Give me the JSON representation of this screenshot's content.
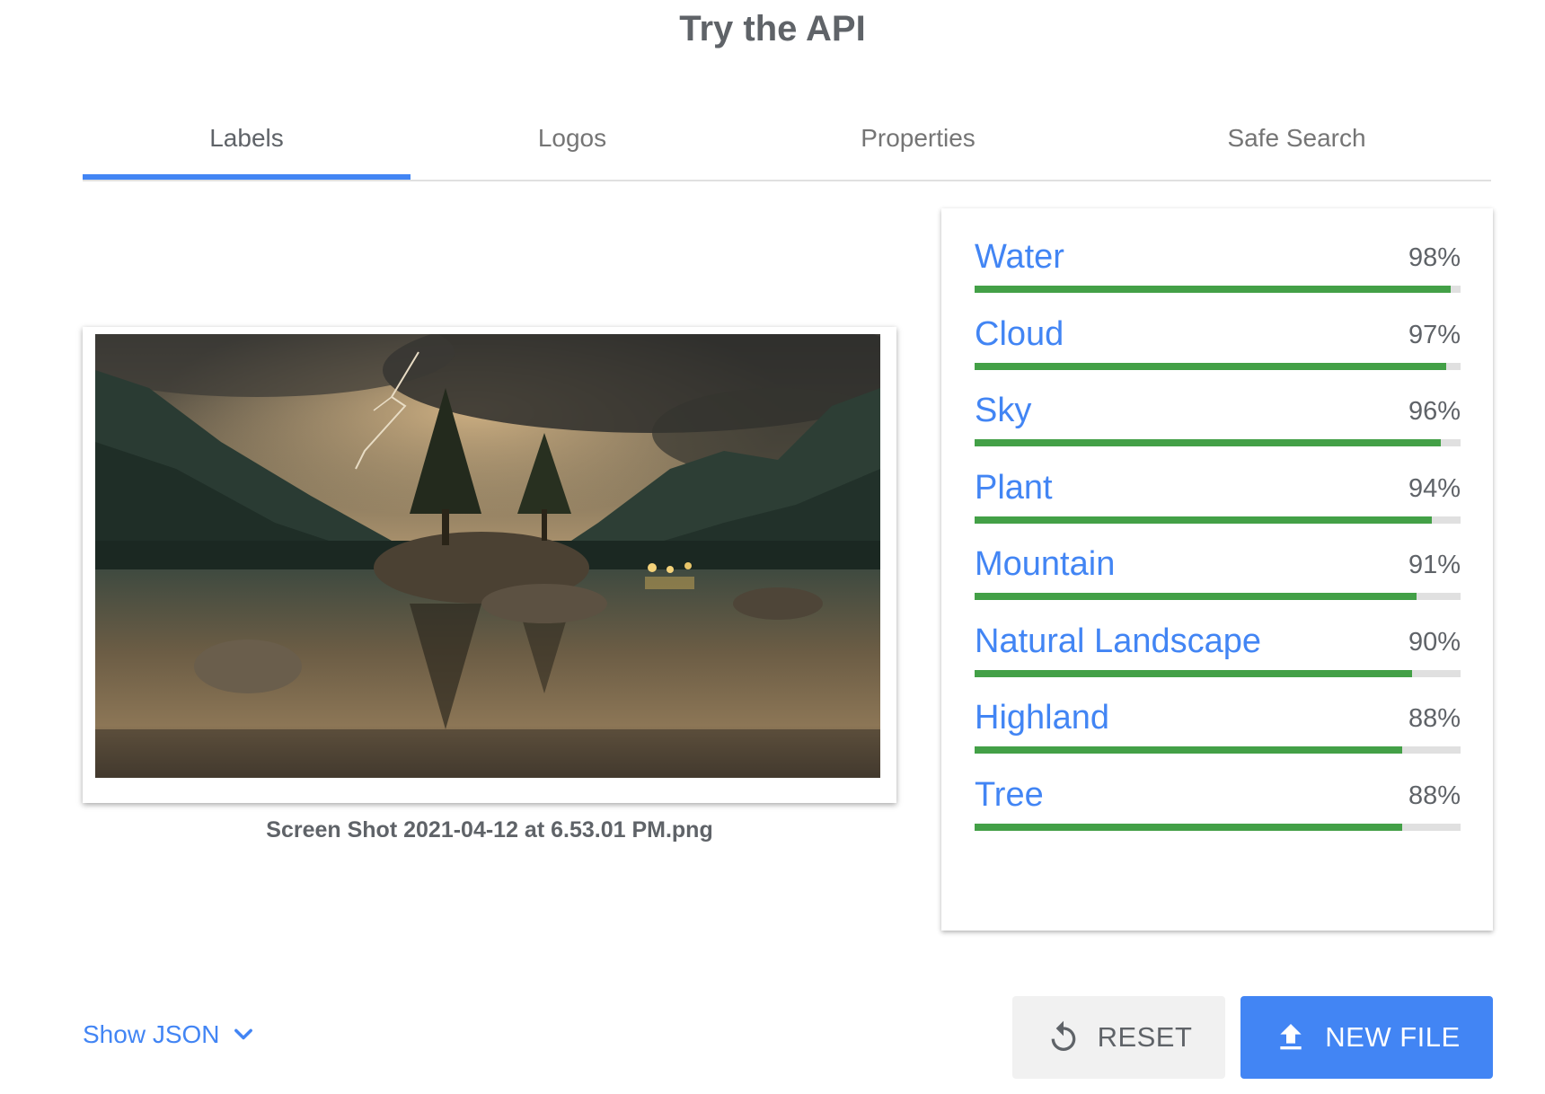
{
  "title": "Try the API",
  "tabs": [
    {
      "label": "Labels",
      "active": true
    },
    {
      "label": "Logos",
      "active": false
    },
    {
      "label": "Properties",
      "active": false
    },
    {
      "label": "Safe Search",
      "active": false
    }
  ],
  "preview": {
    "filename": "Screen Shot 2021-04-12 at 6.53.01 PM.png"
  },
  "labels": [
    {
      "name": "Water",
      "score": "98%",
      "value": 0.98
    },
    {
      "name": "Cloud",
      "score": "97%",
      "value": 0.97
    },
    {
      "name": "Sky",
      "score": "96%",
      "value": 0.96
    },
    {
      "name": "Plant",
      "score": "94%",
      "value": 0.94
    },
    {
      "name": "Mountain",
      "score": "91%",
      "value": 0.91
    },
    {
      "name": "Natural Landscape",
      "score": "90%",
      "value": 0.9
    },
    {
      "name": "Highland",
      "score": "88%",
      "value": 0.88
    },
    {
      "name": "Tree",
      "score": "88%",
      "value": 0.88
    }
  ],
  "footer": {
    "show_json": "Show JSON",
    "reset": "RESET",
    "new_file": "NEW FILE"
  },
  "colors": {
    "accent": "#4285f4",
    "bar": "#43a047",
    "track": "#e0e0e0"
  },
  "icons": {
    "chevron": "chevron-down-icon",
    "reset": "reset-icon",
    "upload": "upload-icon"
  }
}
